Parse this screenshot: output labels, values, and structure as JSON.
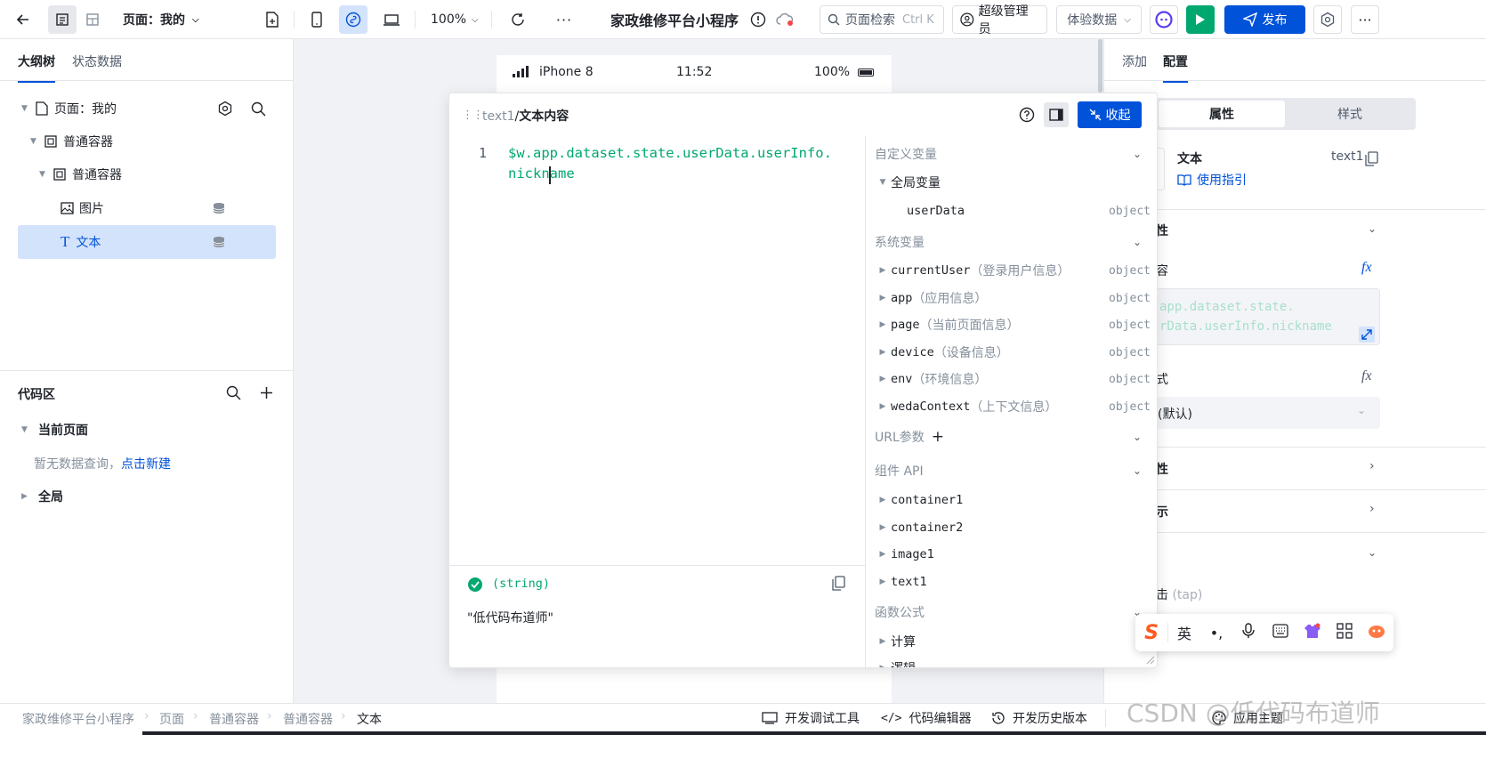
{
  "topbar": {
    "page_label": "页面：我的",
    "zoom": "100%",
    "app_title": "家政维修平台小程序",
    "search_placeholder": "页面检索",
    "search_shortcut": "Ctrl K",
    "role": "超级管理员",
    "env": "体验数据",
    "publish": "发布"
  },
  "left": {
    "tabs": [
      "大纲树",
      "状态数据"
    ],
    "tree": {
      "page": "页面：我的",
      "container1": "普通容器",
      "container2": "普通容器",
      "image": "图片",
      "text": "文本"
    },
    "code_area": {
      "title": "代码区",
      "current_page": "当前页面",
      "empty": "暂无数据查询，",
      "create": "点击新建",
      "global": "全局"
    }
  },
  "phone": {
    "carrier": "iPhone 8",
    "time": "11:52",
    "battery": "100%"
  },
  "editor": {
    "path_id": "text1",
    "path_sep": "/",
    "path_name": "文本内容",
    "collapse": "收起",
    "line_no": "1",
    "code_line1": "$w.app.dataset.state.userData.userInfo.",
    "code_line2": "nickname",
    "result_type": "(string)",
    "result_value": "\"低代码布道师\""
  },
  "vars": {
    "custom": "自定义变量",
    "global": "全局变量",
    "userData": "userData",
    "object": "object",
    "system": "系统变量",
    "items": [
      {
        "name": "currentUser",
        "desc": "（登录用户信息）"
      },
      {
        "name": "app",
        "desc": "（应用信息）"
      },
      {
        "name": "page",
        "desc": "（当前页面信息）"
      },
      {
        "name": "device",
        "desc": "（设备信息）"
      },
      {
        "name": "env",
        "desc": "（环境信息）"
      },
      {
        "name": "wedaContext",
        "desc": "（上下文信息）"
      }
    ],
    "url": "URL参数",
    "component_api": "组件 API",
    "components": [
      "container1",
      "container2",
      "image1",
      "text1"
    ],
    "func": "函数公式",
    "funcs": [
      "计算",
      "逻辑"
    ]
  },
  "right": {
    "tabs": [
      "添加",
      "配置"
    ],
    "seg": [
      "属性",
      "样式"
    ],
    "comp_name": "文本",
    "comp_id": "text1",
    "guide": "使用指引",
    "section1": "性",
    "content_label": "容",
    "content_value1": "app.dataset.state.",
    "content_value2": "rData.userInfo.nickname",
    "style_label": "式",
    "style_value": "(默认)",
    "section2": "性",
    "section3": "示",
    "event": "击",
    "event_tap": "(tap)"
  },
  "ime": {
    "lang": "英"
  },
  "statusbar": {
    "crumbs": [
      "家政维修平台小程序",
      "页面",
      "普通容器",
      "普通容器",
      "文本"
    ],
    "tools": [
      "开发调试工具",
      "代码编辑器",
      "开发历史版本"
    ],
    "theme": "应用主题"
  },
  "watermark": "CSDN @低代码布道师"
}
